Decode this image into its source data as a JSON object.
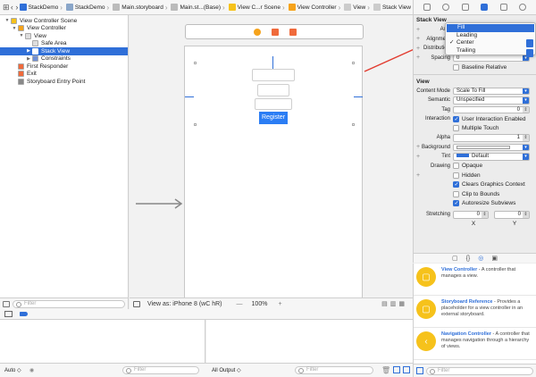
{
  "jumpbar": {
    "crumbs": [
      {
        "label": "StackDemo",
        "color": "#2f6fd8"
      },
      {
        "label": "StackDemo",
        "color": "#8aa6c9"
      },
      {
        "label": "Main.storyboard",
        "color": "#bbbbbb"
      },
      {
        "label": "Main.st...(Base)",
        "color": "#bbbbbb"
      },
      {
        "label": "View C...r Scene",
        "color": "#f6c21b"
      },
      {
        "label": "View Controller",
        "color": "#f6a31b"
      },
      {
        "label": "View",
        "color": "#cccccc"
      },
      {
        "label": "Stack View",
        "color": "#cccccc"
      }
    ]
  },
  "outline": {
    "items": [
      {
        "label": "View Controller Scene",
        "indent": 0,
        "icon": "scene-icon",
        "tri": "▼",
        "color": "#f6c21b"
      },
      {
        "label": "View Controller",
        "indent": 1,
        "icon": "view-controller-icon",
        "tri": "▼",
        "color": "#f6a31b"
      },
      {
        "label": "View",
        "indent": 2,
        "icon": "view-icon",
        "tri": "▼",
        "color": "#dddddd"
      },
      {
        "label": "Safe Area",
        "indent": 3,
        "icon": "safe-area-icon",
        "tri": "",
        "color": "#dddddd"
      },
      {
        "label": "Stack View",
        "indent": 3,
        "icon": "stack-view-icon",
        "tri": "▶",
        "color": "#ffffff",
        "selected": true
      },
      {
        "label": "Constraints",
        "indent": 3,
        "icon": "constraints-icon",
        "tri": "▶",
        "color": "#6e8fd6"
      },
      {
        "label": "First Responder",
        "indent": 1,
        "icon": "first-responder-icon",
        "tri": "",
        "color": "#f06a3b"
      },
      {
        "label": "Exit",
        "indent": 1,
        "icon": "exit-icon",
        "tri": "",
        "color": "#f06a3b"
      },
      {
        "label": "Storyboard Entry Point",
        "indent": 1,
        "icon": "entry-arrow-icon",
        "tri": "",
        "color": "#888888"
      }
    ],
    "filter_placeholder": "Filter"
  },
  "canvas": {
    "register_label": "Register",
    "view_as": "View as: iPhone 8 (wC hR)",
    "zoom": "100%",
    "zoom_out": "—",
    "zoom_in": "+"
  },
  "inspector": {
    "stack_title": "Stack View",
    "axis_label": "Axis",
    "alignment_label": "Alignment",
    "distribution_label": "Distribution",
    "spacing_label": "Spacing",
    "spacing_value": "0",
    "baseline_label": "Baseline Relative",
    "view_title": "View",
    "content_mode_label": "Content Mode",
    "content_mode_value": "Scale To Fill",
    "semantic_label": "Semantic",
    "semantic_value": "Unspecified",
    "tag_label": "Tag",
    "tag_value": "0",
    "interaction_label": "Interaction",
    "user_interaction": "User Interaction Enabled",
    "multiple_touch": "Multiple Touch",
    "alpha_label": "Alpha",
    "alpha_value": "1",
    "background_label": "Background",
    "tint_label": "Tint",
    "tint_value": "Default",
    "drawing_label": "Drawing",
    "opaque": "Opaque",
    "hidden": "Hidden",
    "clears_context": "Clears Graphics Context",
    "clip_bounds": "Clip to Bounds",
    "autoresize": "Autoresize Subviews",
    "stretching_label": "Stretching",
    "stretch_x_value": "0",
    "stretch_y_value": "0",
    "x_label": "X",
    "y_label": "Y",
    "accent": "#2f6fd8"
  },
  "menu": {
    "items": [
      {
        "label": "Fill",
        "highlighted": true,
        "checked": false
      },
      {
        "label": "Leading",
        "highlighted": false,
        "checked": false
      },
      {
        "label": "Center",
        "highlighted": false,
        "checked": true
      },
      {
        "label": "Trailing",
        "highlighted": false,
        "checked": false
      }
    ]
  },
  "library": {
    "items": [
      {
        "title": "View Controller",
        "desc": " - A controller that manages a view.",
        "icon": "view-controller-lib-icon",
        "glyph": "▢"
      },
      {
        "title": "Storyboard Reference",
        "desc": " - Provides a placeholder for a view controller in an external storyboard.",
        "icon": "storyboard-reference-icon",
        "glyph": "▢"
      },
      {
        "title": "Navigation Controller",
        "desc": " - A controller that manages navigation through a hierarchy of views.",
        "icon": "navigation-controller-icon",
        "glyph": "‹"
      }
    ],
    "filter_placeholder": "Filter"
  },
  "debug": {
    "auto_label": "Auto ◇",
    "filter_placeholder": "Filter",
    "output_label": "All Output ◇",
    "filter2_placeholder": "Filter"
  }
}
